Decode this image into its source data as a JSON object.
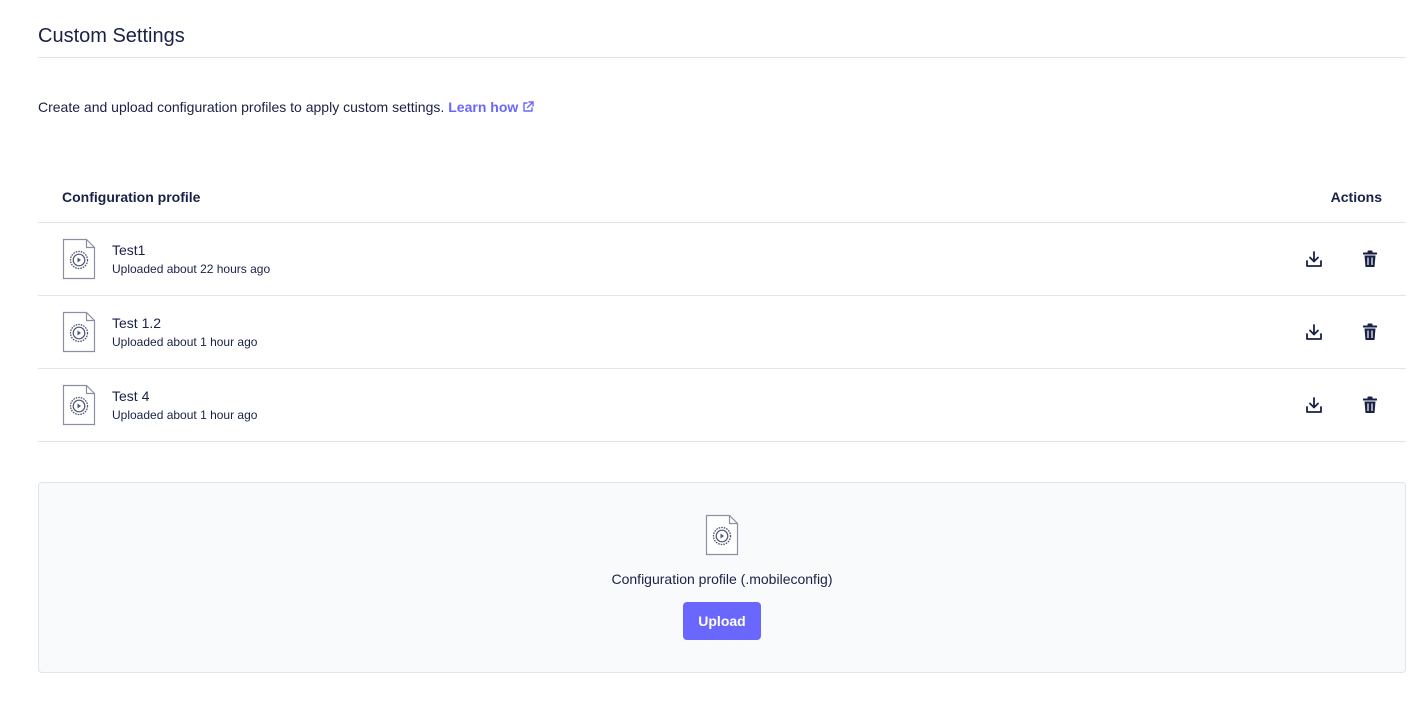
{
  "header": {
    "title": "Custom Settings"
  },
  "intro": {
    "text": "Create and upload configuration profiles to apply custom settings.",
    "link_label": "Learn how",
    "link_icon": "external-link-icon"
  },
  "table": {
    "columns": [
      "Configuration profile",
      "Actions"
    ],
    "rows": [
      {
        "name": "Test1",
        "uploaded": "Uploaded about 22 hours ago"
      },
      {
        "name": "Test 1.2",
        "uploaded": "Uploaded about 1 hour ago"
      },
      {
        "name": "Test 4",
        "uploaded": "Uploaded about 1 hour ago"
      }
    ],
    "row_icons": {
      "file": "profile-file-icon",
      "download": "download-icon",
      "delete": "trash-icon"
    }
  },
  "upload": {
    "icon": "profile-file-icon",
    "label": "Configuration profile (.mobileconfig)",
    "button_label": "Upload"
  },
  "colors": {
    "accent": "#6a67fe",
    "text": "#192147",
    "border": "#e2e4ea",
    "upload_bg": "#f9fafc"
  }
}
